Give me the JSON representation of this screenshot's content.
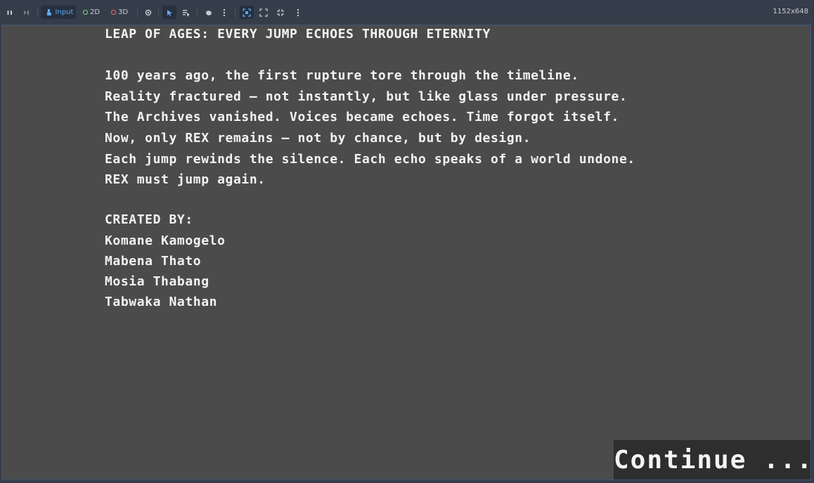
{
  "toolbar": {
    "input_label": "Input",
    "twod_label": "2D",
    "threed_label": "3D",
    "resolution": "1152x648",
    "icons": [
      "pause-icon",
      "step-icon",
      "input-icon",
      "eye-icon",
      "select-icon",
      "list-select-icon",
      "camera-icon",
      "more-icon",
      "focus-icon",
      "expand-icon",
      "collapse-icon",
      "more-icon"
    ],
    "colors": {
      "input_accent": "#5fa8ff",
      "twod_ring": "#7dd87d",
      "threed_ring": "#ff6b6b"
    }
  },
  "game": {
    "title": "LEAP OF AGES: EVERY JUMP ECHOES THROUGH ETERNITY",
    "story": [
      "100 years ago, the first rupture tore through the timeline.",
      "Reality fractured — not instantly, but like glass under pressure.",
      "The Archives vanished. Voices became echoes. Time forgot itself.",
      "Now, only REX remains — not by chance, but by design.",
      "Each jump rewinds the silence. Each echo speaks of a world undone.",
      "REX must jump again."
    ],
    "credits_heading": "CREATED BY:",
    "credits": [
      "Komane Kamogelo",
      "Mabena Thato",
      "Mosia Thabang",
      "Tabwaka Nathan"
    ],
    "continue_label": "Continue ..."
  }
}
